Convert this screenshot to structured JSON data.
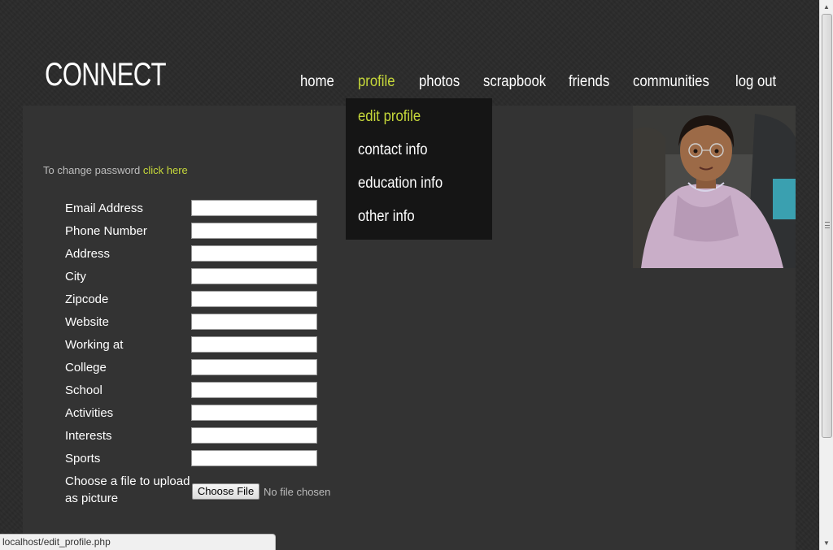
{
  "site": {
    "logo": "CONNECT"
  },
  "nav": {
    "home": "home",
    "profile": "profile",
    "photos": "photos",
    "scrapbook": "scrapbook",
    "friends": "friends",
    "communities": "communities",
    "logout": "log out"
  },
  "profile_menu": {
    "edit_profile": "edit profile",
    "contact_info": "contact info",
    "education_info": "education info",
    "other_info": "other info"
  },
  "password": {
    "text": "To change password",
    "link": "click here"
  },
  "form": {
    "fields": [
      {
        "label": "Email Address",
        "value": ""
      },
      {
        "label": "Phone Number",
        "value": ""
      },
      {
        "label": "Address",
        "value": ""
      },
      {
        "label": "City",
        "value": ""
      },
      {
        "label": "Zipcode",
        "value": ""
      },
      {
        "label": "Website",
        "value": ""
      },
      {
        "label": "Working at",
        "value": ""
      },
      {
        "label": "College",
        "value": ""
      },
      {
        "label": "School",
        "value": ""
      },
      {
        "label": "Activities",
        "value": ""
      },
      {
        "label": "Interests",
        "value": ""
      },
      {
        "label": "Sports",
        "value": ""
      }
    ],
    "file_label_line1": "Choose a file to upload",
    "file_label_line2": "as picture",
    "file_button": "Choose File",
    "file_status": "No file chosen"
  },
  "browser": {
    "status_url": "localhost/edit_profile.php"
  },
  "colors": {
    "accent": "#c6d83a",
    "panel": "#333333",
    "dropdown": "#151515"
  }
}
